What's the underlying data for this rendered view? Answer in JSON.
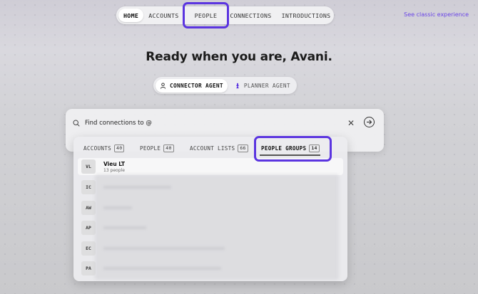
{
  "nav": {
    "items": [
      {
        "label": "HOME",
        "active": true
      },
      {
        "label": "ACCOUNTS",
        "active": false
      },
      {
        "label": "PEOPLE",
        "active": false
      },
      {
        "label": "CONNECTIONS",
        "active": false
      },
      {
        "label": "INTRODUCTIONS",
        "active": false
      }
    ],
    "classic_link": "See classic experience"
  },
  "headline": "Ready when you are, Avani.",
  "agents": {
    "connector": "CONNECTOR AGENT",
    "planner": "PLANNER AGENT"
  },
  "search": {
    "value": "Find connections to @"
  },
  "tabs": {
    "accounts": {
      "label": "ACCOUNTS",
      "count": "40"
    },
    "people": {
      "label": "PEOPLE",
      "count": "40"
    },
    "account_lists": {
      "label": "ACCOUNT LISTS",
      "count": "66"
    },
    "people_groups": {
      "label": "PEOPLE GROUPS",
      "count": "14"
    }
  },
  "results": [
    {
      "initials": "VL",
      "name": "Vieu LT",
      "sub": "13 people"
    },
    {
      "initials": "IC"
    },
    {
      "initials": "AW"
    },
    {
      "initials": "AP"
    },
    {
      "initials": "EC"
    },
    {
      "initials": "PA"
    }
  ],
  "colors": {
    "highlight": "#5b35e0",
    "link": "#6b46e8"
  }
}
